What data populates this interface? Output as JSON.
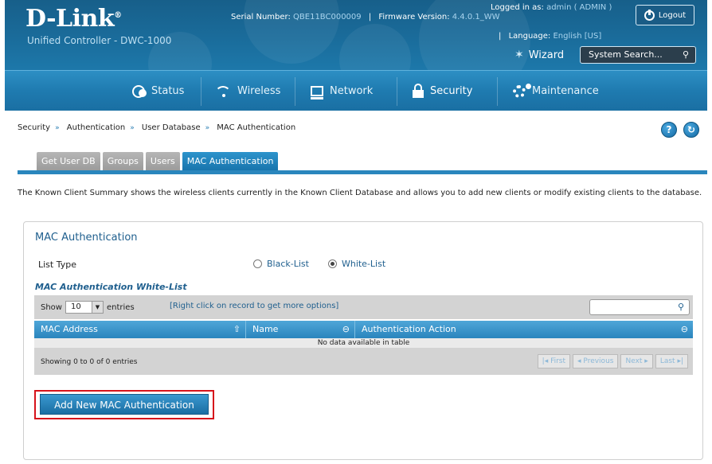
{
  "header": {
    "logo": "D-Link",
    "logo_mark": "®",
    "subtitle": "Unified Controller - DWC-1000",
    "serial_label": "Serial Number:",
    "serial_value": "QBE11BC000009",
    "firmware_label": "Firmware Version:",
    "firmware_value": "4.4.0.1_WW",
    "language_label": "Language:",
    "language_value": "English [US]",
    "logged_in_label": "Logged in as:",
    "logged_in_value": "admin ( ADMIN )",
    "logout": "Logout",
    "wizard": "Wizard",
    "system_search": "System Search..."
  },
  "nav": {
    "items": [
      {
        "label": "Status",
        "icon": "status-icon"
      },
      {
        "label": "Wireless",
        "icon": "wifi-icon"
      },
      {
        "label": "Network",
        "icon": "network-icon"
      },
      {
        "label": "Security",
        "icon": "lock-icon",
        "active": true
      },
      {
        "label": "Maintenance",
        "icon": "gear-icon"
      }
    ]
  },
  "breadcrumb": [
    "Security",
    "Authentication",
    "User Database",
    "MAC Authentication"
  ],
  "breadcrumb_sep": "»",
  "help": {
    "help_label": "?",
    "refresh_label": "↻"
  },
  "tabs": [
    "Get User DB",
    "Groups",
    "Users",
    "MAC Authentication"
  ],
  "active_tab": "MAC Authentication",
  "description": "The Known Client Summary shows the wireless clients currently in the Known Client Database and allows you to add new clients or modify existing clients to the database.",
  "panel": {
    "title": "MAC Authentication",
    "list_type_label": "List Type",
    "radio_black": "Black-List",
    "radio_white": "White-List",
    "selected": "White-List",
    "subhead": "MAC Authentication White-List",
    "show_label": "Show",
    "entries_value": "10",
    "entries_label": "entries",
    "hint": "[Right click on record to get more options]",
    "columns": [
      "MAC Address",
      "Name",
      "Authentication Action"
    ],
    "no_data": "No data available in table",
    "showing": "Showing 0 to 0 of 0 entries",
    "pager": {
      "first": "First",
      "previous": "Previous",
      "next": "Next",
      "last": "Last"
    },
    "add_button": "Add New MAC Authentication"
  },
  "colors": {
    "accent": "#1f7bb0",
    "highlight": "#d6131b",
    "panel_title": "#1f5f8e"
  }
}
